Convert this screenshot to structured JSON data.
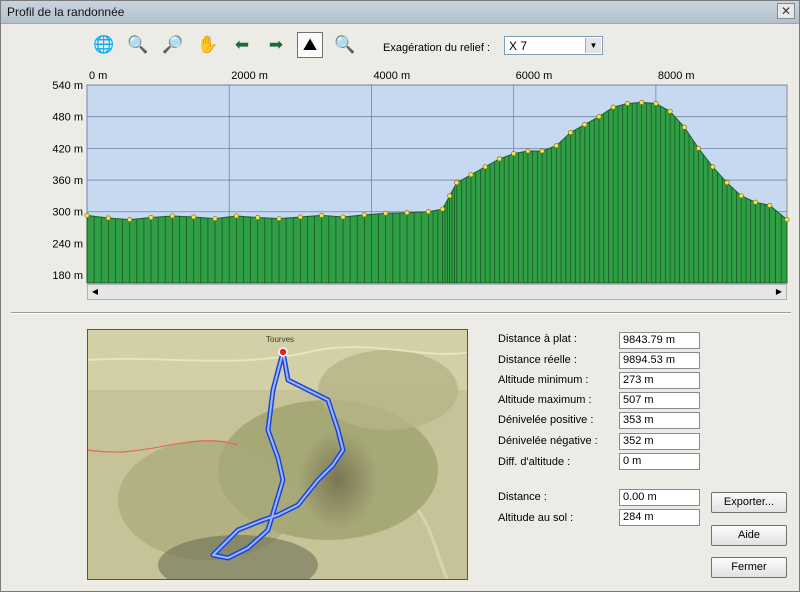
{
  "window": {
    "title": "Profil de la randonnée",
    "close_label": "✕"
  },
  "toolbar": {
    "tools": [
      {
        "name": "globe-search-icon",
        "glyph": "🌐"
      },
      {
        "name": "zoom-in-icon",
        "glyph": "🔍"
      },
      {
        "name": "zoom-out-icon",
        "glyph": "🔎"
      },
      {
        "name": "pan-hand-icon",
        "glyph": "✋"
      },
      {
        "name": "arrow-left-icon",
        "glyph": "⬅"
      },
      {
        "name": "arrow-right-icon",
        "glyph": "➡"
      },
      {
        "name": "profile-view-icon",
        "glyph": "⛰"
      },
      {
        "name": "profile-zoom-icon",
        "glyph": "🔍"
      }
    ],
    "exaggeration_label": "Exagération du relief :",
    "exaggeration_value": "X 7"
  },
  "profile": {
    "x_ticks": [
      "0 m",
      "2000 m",
      "4000 m",
      "6000 m",
      "8000 m"
    ],
    "y_ticks": [
      "540 m",
      "480 m",
      "420 m",
      "360 m",
      "300 m",
      "240 m",
      "180 m"
    ],
    "colors": {
      "sky": "#c6d9f0",
      "terrain": "#2f9e44",
      "point": "#f3e455"
    }
  },
  "chart_data": {
    "type": "area",
    "xlabel": "",
    "ylabel": "",
    "xlim": [
      0,
      9843.79
    ],
    "ylim": [
      165,
      540
    ],
    "x_ticks": [
      0,
      2000,
      4000,
      6000,
      8000
    ],
    "y_ticks": [
      540,
      480,
      420,
      360,
      300,
      240,
      180
    ],
    "grid": true,
    "series": [
      {
        "x": [
          0,
          300,
          600,
          900,
          1200,
          1500,
          1800,
          2100,
          2400,
          2700,
          3000,
          3300,
          3600,
          3900,
          4200,
          4500,
          4800,
          5000,
          5100,
          5200,
          5400,
          5600,
          5800,
          6000,
          6200,
          6400,
          6600,
          6800,
          7000,
          7200,
          7400,
          7600,
          7800,
          8000,
          8200,
          8400,
          8600,
          8800,
          9000,
          9200,
          9400,
          9600,
          9843.79
        ],
        "y": [
          293,
          288,
          285,
          289,
          292,
          290,
          287,
          292,
          289,
          287,
          290,
          293,
          290,
          294,
          297,
          298,
          300,
          305,
          330,
          355,
          370,
          385,
          400,
          410,
          415,
          415,
          425,
          450,
          465,
          480,
          498,
          505,
          507,
          505,
          490,
          460,
          420,
          385,
          355,
          330,
          318,
          312,
          285
        ]
      }
    ]
  },
  "stats": [
    {
      "label": "Distance à plat :",
      "value": "9843.79 m"
    },
    {
      "label": "Distance réelle :",
      "value": "9894.53 m"
    },
    {
      "label": "Altitude minimum :",
      "value": "273 m"
    },
    {
      "label": "Altitude maximum :",
      "value": "507 m"
    },
    {
      "label": "Dénivelée positive :",
      "value": "353 m"
    },
    {
      "label": "Dénivelée négative :",
      "value": "352 m"
    },
    {
      "label": "Diff. d'altitude :",
      "value": "0 m"
    }
  ],
  "cursor": [
    {
      "label": "Distance :",
      "value": "0.00 m"
    },
    {
      "label": "Altitude au sol :",
      "value": "284 m"
    }
  ],
  "buttons": {
    "export": "Exporter...",
    "help": "Aide",
    "close": "Fermer"
  },
  "map": {
    "town_label": "Tourves"
  }
}
